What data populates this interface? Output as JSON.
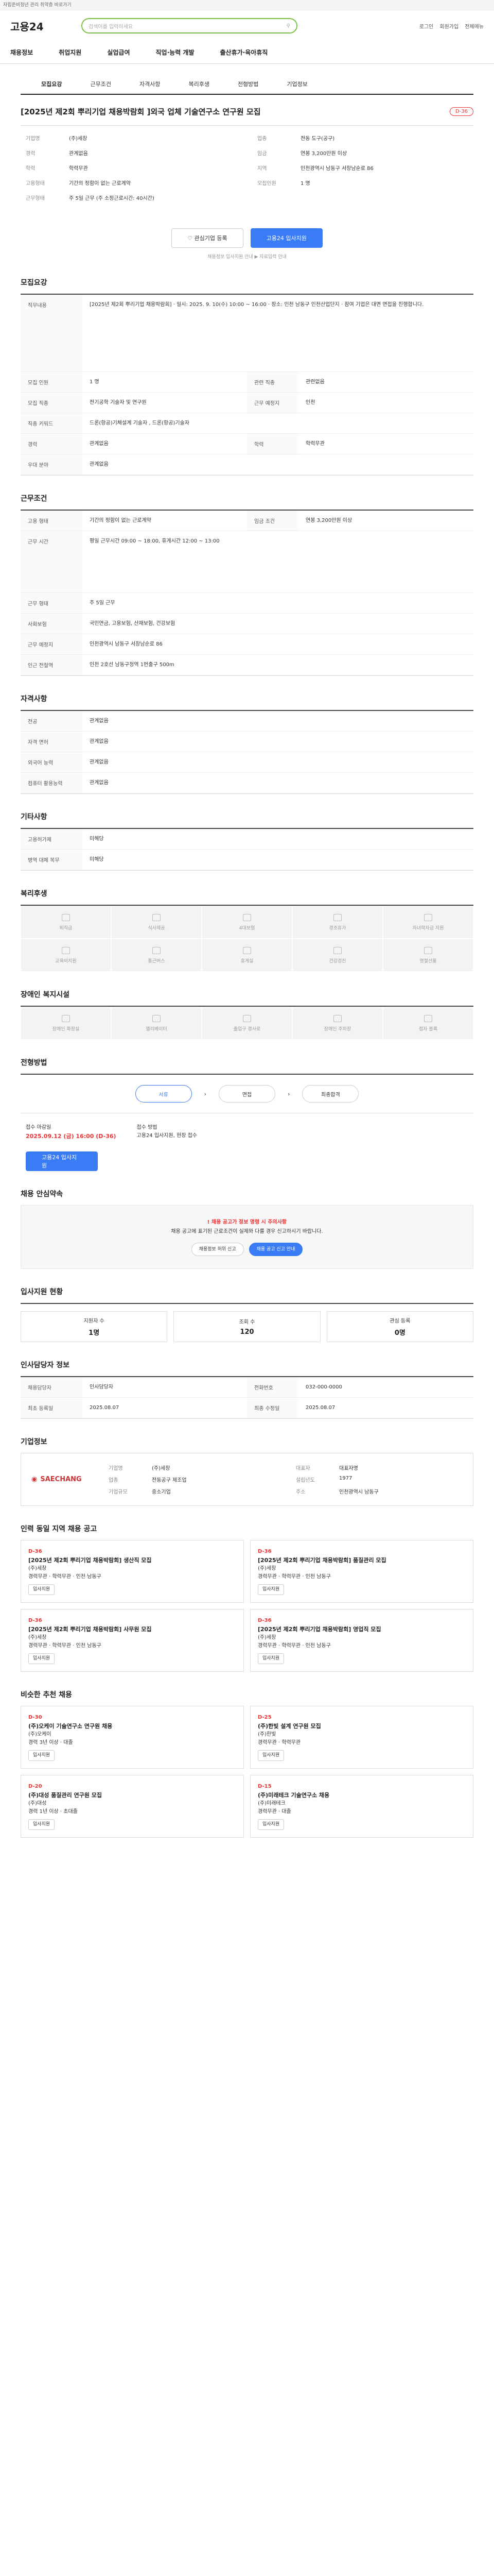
{
  "topbar": {
    "text": "자립준비청년 관리 취약층 바로가기"
  },
  "header": {
    "logo": "고용24",
    "search_placeholder": "검색어를 입력하세요",
    "links": [
      "로그인",
      "회원가입",
      "전체메뉴"
    ]
  },
  "menu": {
    "items": [
      "채용정보",
      "취업지원",
      "실업급여",
      "직업·능력 개발",
      "출산휴가·육아휴직"
    ]
  },
  "tabs": {
    "items": [
      "모집요강",
      "근무조건",
      "자격사항",
      "복리후생",
      "전형방법",
      "기업정보"
    ]
  },
  "job": {
    "title": "[2025년 제2회 뿌리기업 채용박람회 ]외국 업체 기술연구소 연구원 모집",
    "dday": "D-36"
  },
  "summary": {
    "left": [
      {
        "k": "기업명",
        "v": "(주)세창"
      },
      {
        "k": "경력",
        "v": "관계없음"
      },
      {
        "k": "학력",
        "v": "학력무관"
      },
      {
        "k": "고용형태",
        "v": "기간의 정함이 없는 근로계약"
      },
      {
        "k": "근무형태",
        "v": "주 5일 근무 (주 소정근로시간: 40시간)"
      }
    ],
    "right": [
      {
        "k": "업종",
        "v": "전동 도구(공구)"
      },
      {
        "k": "임금",
        "v": "연봉 3,200만원 이상"
      },
      {
        "k": "지역",
        "v": "인천광역시 남동구 서창남순로 86"
      },
      {
        "k": "모집인원",
        "v": "1 명"
      }
    ]
  },
  "actions": {
    "interest": "관심기업 등록",
    "apply": "고용24 입사지원",
    "note": "채용정보 입사지원 안내 ▶ 자료입력 안내"
  },
  "recruit": {
    "heading": "모집요강",
    "rows": [
      {
        "k": "직무내용",
        "v": "[2025년 제2회 뿌리기업 채용박람회] · 일시: 2025. 9. 10(수) 10:00 ~ 16:00 · 장소: 인천 남동구 인천산업단지 · 참여 기업은 대면 면접을 진행합니다."
      },
      {
        "k": "모집 인원",
        "v": "1 명"
      },
      {
        "k": "모집 직종",
        "v": "전기공학 기술자 및 연구원"
      },
      {
        "k": "직종 키워드",
        "v": "드론(항공)기체설계 기술자 , 드론(항공)기술자"
      },
      {
        "k": "경력",
        "v": "관계없음"
      },
      {
        "k": "우대 분야",
        "v": "관계없음"
      }
    ],
    "side": [
      {
        "k": "관련 직종",
        "v": "관련없음"
      },
      {
        "k": "근무 예정지",
        "v": "인천"
      },
      {
        "k": "학력",
        "v": "학력무관"
      }
    ]
  },
  "conditions": {
    "heading": "근무조건",
    "rows": [
      {
        "k": "고용 형태",
        "v": "기간의 정함이 없는 근로계약"
      },
      {
        "k": "임금 조건",
        "v": "연봉 3,200만원 이상"
      },
      {
        "k": "근무 시간",
        "v": "평일 근무시간 09:00 ~ 18:00, 휴게시간 12:00 ~ 13:00"
      },
      {
        "k": "근무 형태",
        "v": "주 5일 근무"
      },
      {
        "k": "사회보험",
        "v": "국민연금, 고용보험, 산재보험, 건강보험"
      },
      {
        "k": "근무 예정지",
        "v": "인천광역시 남동구 서창남순로 86"
      },
      {
        "k": "인근 전철역",
        "v": "인천 2호선 남동구청역 1번출구 500m"
      }
    ]
  },
  "qualifications": {
    "heading": "자격사항",
    "rows": [
      {
        "k": "전공",
        "v": "관계없음"
      },
      {
        "k": "자격 면허",
        "v": "관계없음"
      },
      {
        "k": "외국어 능력",
        "v": "관계없음"
      },
      {
        "k": "컴퓨터 활용능력",
        "v": "관계없음"
      }
    ]
  },
  "other": {
    "heading": "기타사항",
    "rows": [
      {
        "k": "고용허가제",
        "v": "미해당"
      },
      {
        "k": "병역 대체 복무",
        "v": "미해당"
      }
    ]
  },
  "welfare": {
    "heading": "복리후생",
    "items": [
      "퇴직금",
      "식사제공",
      "4대보험",
      "경조휴가",
      "자녀학자금 지원",
      "교육비지원",
      "통근버스",
      "휴게실",
      "건강검진",
      "명절선물"
    ]
  },
  "handicap": {
    "heading": "장애인 복지시설",
    "items": [
      "장애인 화장실",
      "엘리베이터",
      "출입구 경사로",
      "장애인 주차장",
      "점자 블록"
    ]
  },
  "process": {
    "heading": "전형방법",
    "steps": [
      "서류",
      "면접",
      "최종합격"
    ],
    "period_label": "접수 마감일",
    "deadline": "2025.09.12 (금) 16:00",
    "deadline_note": "(D-36)",
    "method_label": "접수 방법",
    "method": "고용24 입사지원, 현장 접수",
    "apply_btn": "고용24 입사지원"
  },
  "safety": {
    "heading": "채용 안심약속",
    "warn": "! 채용 공고가 정보 명령 시 주의사항",
    "text": "채용 공고에 표기된 근로조건이 실제와 다를 경우 신고하시기 바랍니다.",
    "chips": [
      "채용정보 허위 신고",
      "채용 공고 신고 안내"
    ]
  },
  "stats": {
    "heading": "입사지원 현황",
    "items": [
      {
        "label": "지원자 수",
        "v": "1명"
      },
      {
        "label": "조회 수",
        "v": "120"
      },
      {
        "label": "관심 등록",
        "v": "0명"
      }
    ]
  },
  "manager": {
    "heading": "인사담당자 정보",
    "rows": [
      {
        "k": "채용담당자",
        "v": "인사담당자"
      },
      {
        "k": "전화번호",
        "v": "032-000-0000"
      },
      {
        "k": "최초 등록일",
        "v": "2025.08.07"
      },
      {
        "k": "최종 수정일",
        "v": "2025.08.07"
      }
    ]
  },
  "company": {
    "heading": "기업정보",
    "logo": "SAECHANG",
    "rows": [
      {
        "k": "기업명",
        "v": "(주)세창"
      },
      {
        "k": "대표자",
        "v": "대표자명"
      },
      {
        "k": "업종",
        "v": "전동공구 제조업"
      },
      {
        "k": "설립년도",
        "v": "1977"
      },
      {
        "k": "기업규모",
        "v": "중소기업"
      },
      {
        "k": "주소",
        "v": "인천광역시 남동구"
      }
    ]
  },
  "related": {
    "heading": "인력 동일 지역 채용 공고",
    "jobs": [
      {
        "dday": "D-36",
        "title": "[2025년 제2회 뿌리기업 채용박람회] 생산직 모집",
        "company": "(주)세창",
        "cond": "경력무관 · 학력무관 · 인천 남동구",
        "btn": "입사지원"
      },
      {
        "dday": "D-36",
        "title": "[2025년 제2회 뿌리기업 채용박람회] 품질관리 모집",
        "company": "(주)세창",
        "cond": "경력무관 · 학력무관 · 인천 남동구",
        "btn": "입사지원"
      },
      {
        "dday": "D-36",
        "title": "[2025년 제2회 뿌리기업 채용박람회] 사무원 모집",
        "company": "(주)세창",
        "cond": "경력무관 · 학력무관 · 인천 남동구",
        "btn": "입사지원"
      },
      {
        "dday": "D-36",
        "title": "[2025년 제2회 뿌리기업 채용박람회] 영업직 모집",
        "company": "(주)세창",
        "cond": "경력무관 · 학력무관 · 인천 남동구",
        "btn": "입사지원"
      }
    ]
  },
  "recommend": {
    "heading": "비슷한 추천 채용",
    "jobs": [
      {
        "dday": "D-30",
        "title": "(주)오케이 기술연구소 연구원 채용",
        "company": "(주)오케이",
        "cond": "경력 3년 이상 · 대졸",
        "btn": "입사지원"
      },
      {
        "dday": "D-25",
        "title": "(주)한빛 설계 연구원 모집",
        "company": "(주)한빛",
        "cond": "경력무관 · 학력무관",
        "btn": "입사지원"
      },
      {
        "dday": "D-20",
        "title": "(주)대성 품질관리 연구원 모집",
        "company": "(주)대성",
        "cond": "경력 1년 이상 · 초대졸",
        "btn": "입사지원"
      },
      {
        "dday": "D-15",
        "title": "(주)미래테크 기술연구소 채용",
        "company": "(주)미래테크",
        "cond": "경력무관 · 대졸",
        "btn": "입사지원"
      }
    ]
  }
}
